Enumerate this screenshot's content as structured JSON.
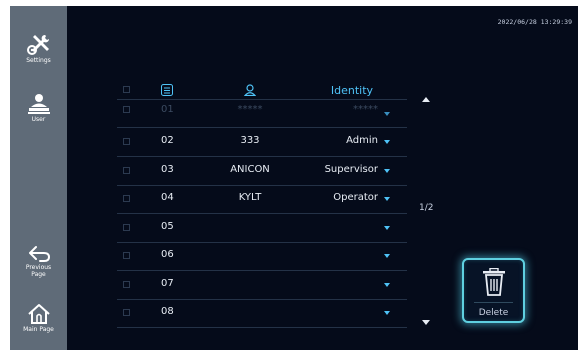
{
  "timestamp": "2022/06/28 13:29:39",
  "sidebar": {
    "settings_label": "Settings",
    "user_label": "User",
    "previous_label": "Previous\nPage",
    "main_label": "Main Page"
  },
  "table": {
    "header_identity": "Identity",
    "rows": [
      {
        "num": "01",
        "name": "*****",
        "identity": "*****"
      },
      {
        "num": "02",
        "name": "333",
        "identity": "Admin"
      },
      {
        "num": "03",
        "name": "ANICON",
        "identity": "Supervisor"
      },
      {
        "num": "04",
        "name": "KYLT",
        "identity": "Operator"
      },
      {
        "num": "05",
        "name": "",
        "identity": ""
      },
      {
        "num": "06",
        "name": "",
        "identity": ""
      },
      {
        "num": "07",
        "name": "",
        "identity": ""
      },
      {
        "num": "08",
        "name": "",
        "identity": ""
      }
    ]
  },
  "pager": {
    "indicator": "1/2"
  },
  "delete_label": "Delete",
  "colors": {
    "accent": "#4fc3f7",
    "sidebar": "#5f6b78",
    "background": "#050b1a",
    "glow": "#5fd0e0"
  }
}
